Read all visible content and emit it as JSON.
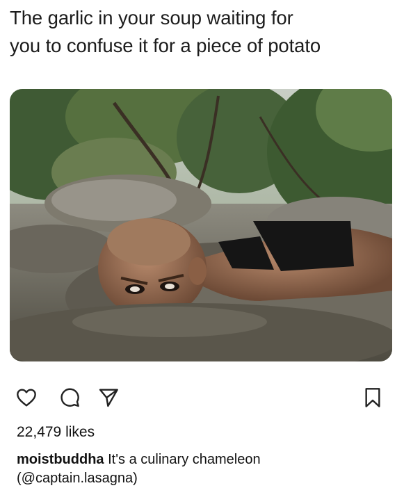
{
  "post": {
    "caption_lines": [
      "The garlic in your soup waiting for",
      "you to confuse it for a piece of potato"
    ],
    "image_label": "man lying face-down in a rocky stream, only head peeking above the water",
    "actions": {
      "like_icon": "heart-icon",
      "comment_icon": "comment-icon",
      "share_icon": "send-icon",
      "save_icon": "bookmark-icon"
    },
    "likes": "22,479 likes",
    "comment": {
      "username": "moistbuddha",
      "text": "It's a culinary chameleon",
      "mention_line": "(@captain.lasagna)"
    }
  }
}
